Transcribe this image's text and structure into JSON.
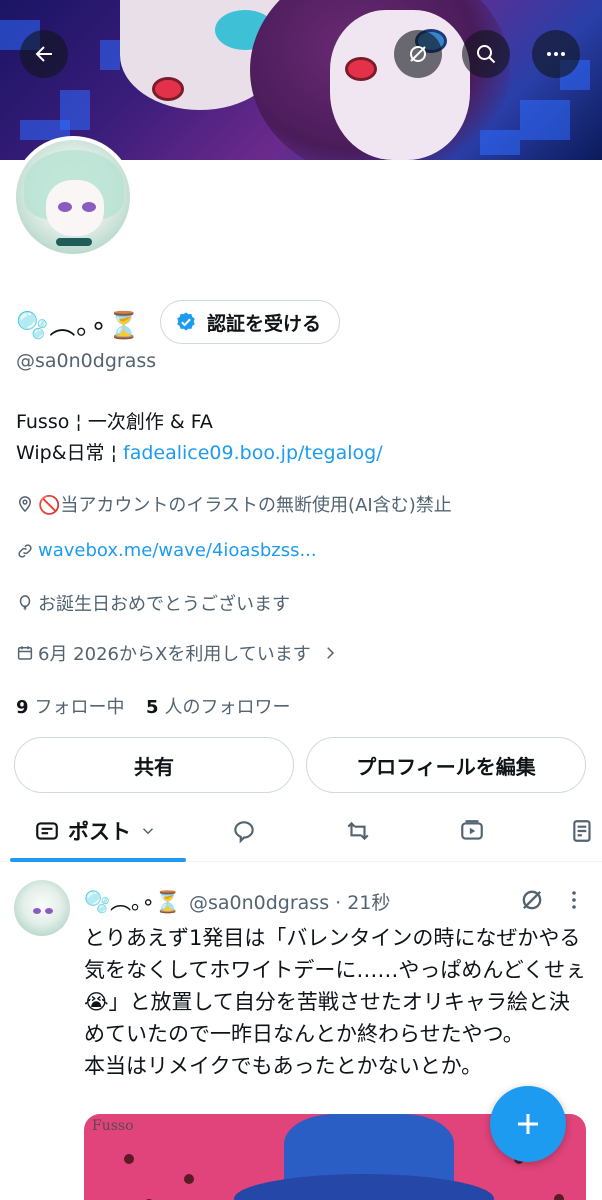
{
  "profile": {
    "display_name": "🫧︵｡∘⏳",
    "verify_label": "認証を受ける",
    "handle": "@sa0n0dgrass",
    "bio_line1": "Fusso ¦ 一次創作 & FA",
    "bio_line2_prefix": "Wip&日常 ¦ ",
    "bio_line2_link": "fadealice09.boo.jp/tegalog/",
    "location_notice": "🚫当アカウントのイラストの無断使用(AI含む)禁止",
    "website": "wavebox.me/wave/4ioasbzss...",
    "birthday": "お誕生日おめでとうございます",
    "joined": "6月 2026からXを利用しています",
    "following_count": "9",
    "following_label": "フォロー中",
    "followers_count": "5",
    "followers_label": "人のフォロワー"
  },
  "actions": {
    "share_label": "共有",
    "edit_label": "プロフィールを編集"
  },
  "tabs": {
    "posts_label": "ポスト"
  },
  "post": {
    "display_name": "🫧︵｡∘⏳",
    "handle_time": "@sa0n0dgrass · 21秒",
    "text": "とりあえず1発目は「バレンタインの時になぜかやる気をなくしてホワイトデーに……やっぱめんどくせぇ😭」と放置して自分を苦戦させたオリキャラ絵と決めていたので一昨日なんとか終わらせたやつ。\n本当はリメイクでもあったとかないとか。",
    "image_watermark": "Fusso"
  },
  "colors": {
    "accent": "#1d9bf0",
    "text_primary": "#0f1419",
    "text_secondary": "#536471"
  }
}
